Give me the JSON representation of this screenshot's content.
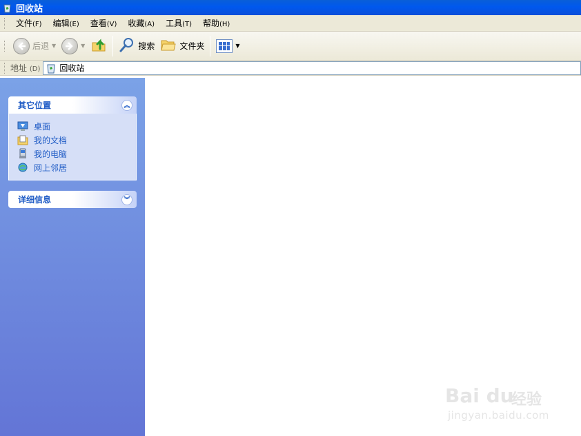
{
  "window": {
    "title": "回收站",
    "icon": "recycle-bin-icon"
  },
  "menu": [
    {
      "label": "文件",
      "accel": "(F)"
    },
    {
      "label": "编辑",
      "accel": "(E)"
    },
    {
      "label": "查看",
      "accel": "(V)"
    },
    {
      "label": "收藏",
      "accel": "(A)"
    },
    {
      "label": "工具",
      "accel": "(T)"
    },
    {
      "label": "帮助",
      "accel": "(H)"
    }
  ],
  "toolbar": {
    "back_label": "后退",
    "search_label": "搜索",
    "folders_label": "文件夹"
  },
  "address": {
    "label": "地址",
    "accel": "(D)",
    "value": "回收站"
  },
  "taskpane": {
    "other_places": {
      "title": "其它位置",
      "items": [
        {
          "label": "桌面",
          "icon": "desktop-icon"
        },
        {
          "label": "我的文档",
          "icon": "my-documents-icon"
        },
        {
          "label": "我的电脑",
          "icon": "my-computer-icon"
        },
        {
          "label": "网上邻居",
          "icon": "network-places-icon"
        }
      ]
    },
    "details": {
      "title": "详细信息"
    }
  },
  "watermark": {
    "brand": "Bai du",
    "brand_cn": "经验",
    "url": "jingyan.baidu.com"
  },
  "colors": {
    "titlebar": "#0058ee",
    "taskpane_top": "#7ba2e7",
    "taskpane_bottom": "#6375d6",
    "link": "#215dc6"
  }
}
